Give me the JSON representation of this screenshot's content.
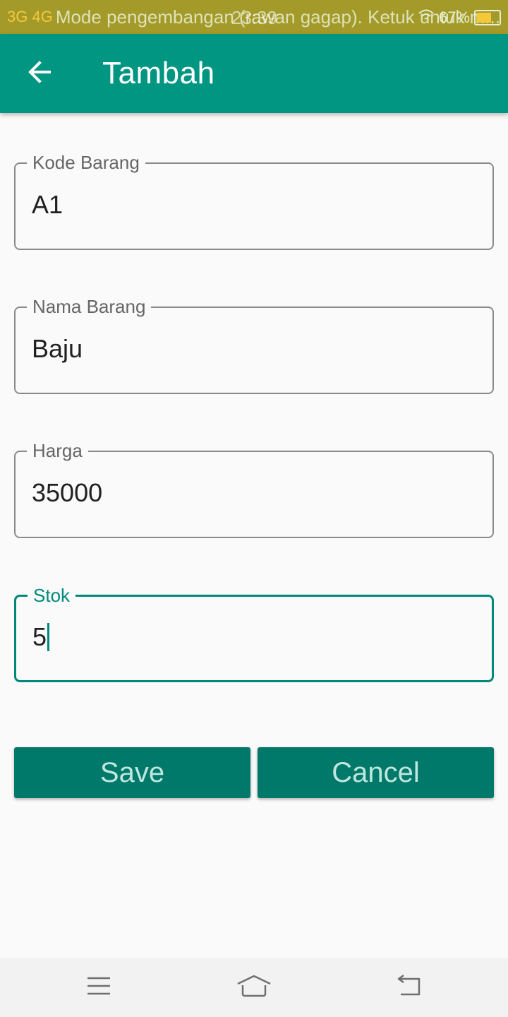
{
  "status_bar": {
    "network": "3G 4G",
    "developer_text": "Mode pengembangan (rawan gagap). Ketuk untuk m...",
    "time": "23:39",
    "battery": "67%"
  },
  "app_bar": {
    "title": "Tambah",
    "back_icon": "arrow-back-icon"
  },
  "form": {
    "fields": [
      {
        "label": "Kode Barang",
        "value": "A1"
      },
      {
        "label": "Nama Barang",
        "value": "Baju"
      },
      {
        "label": "Harga",
        "value": "35000"
      },
      {
        "label": "Stok",
        "value": "5"
      }
    ],
    "focused_field": "Stok"
  },
  "buttons": {
    "save_label": "Save",
    "cancel_label": "Cancel"
  },
  "colors": {
    "app_bar": "#009682",
    "buttons": "#00796b",
    "focus": "#00897b",
    "status_bar": "#a39a2a"
  },
  "nav_bar": {
    "icons": [
      "menu-icon",
      "home-icon",
      "back-icon"
    ]
  }
}
